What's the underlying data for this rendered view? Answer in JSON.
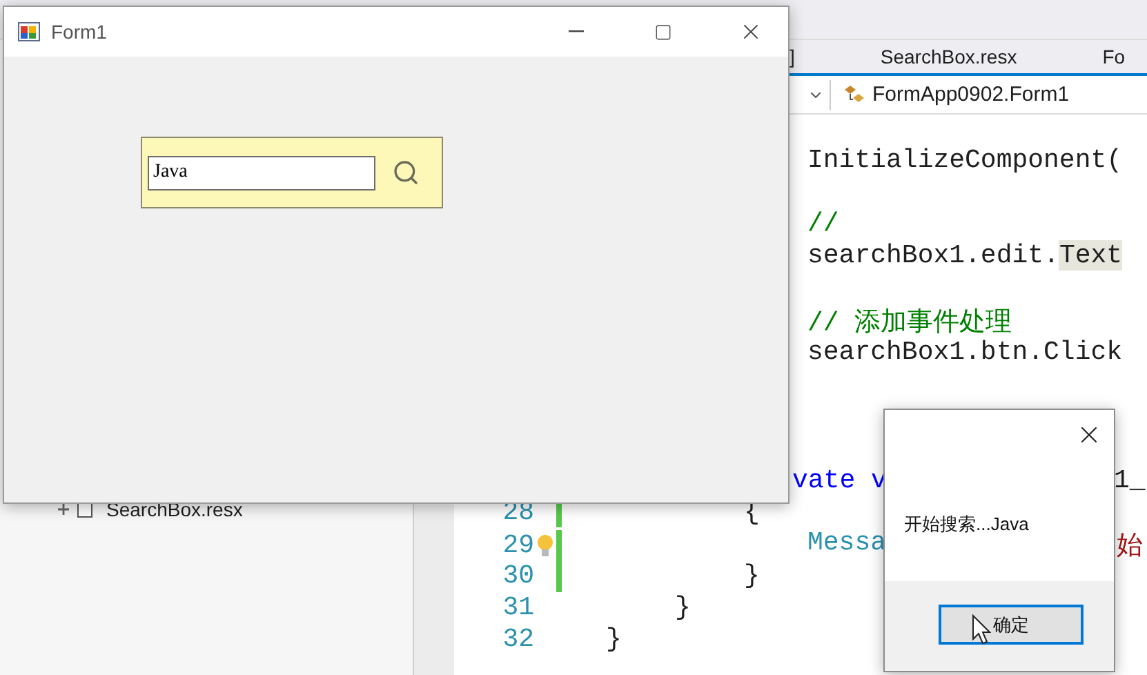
{
  "ide": {
    "tabs": [
      {
        "label": "]",
        "selected": false
      },
      {
        "label": "SearchBox.resx",
        "selected": false
      },
      {
        "label": "Fo",
        "selected": false
      }
    ],
    "navigation_bar": {
      "type_dropdown": "FormApp0902.Form1"
    },
    "solution_explorer": {
      "items": [
        {
          "label": "SearchBox.resx",
          "expanded": false
        }
      ]
    },
    "editor": {
      "lines": [
        {
          "segments": [
            {
              "text": "InitializeComponent(",
              "kind": "plain"
            }
          ]
        },
        {
          "segments": [
            {
              "text": "//",
              "kind": "comment"
            }
          ]
        },
        {
          "segments": [
            {
              "text": "searchBox1.edit.",
              "kind": "plain"
            },
            {
              "text": "Text",
              "kind": "highlight"
            }
          ]
        },
        {
          "segments": [
            {
              "text": "// 添加事件处理",
              "kind": "comment"
            }
          ]
        },
        {
          "segments": [
            {
              "text": "searchBox1.btn.Click",
              "kind": "plain"
            }
          ]
        },
        {
          "segments": [
            {
              "text": "vate v",
              "kind": "keyword"
            },
            {
              "text": "1_",
              "kind": "plain"
            }
          ]
        },
        {
          "number": "28",
          "changed": true,
          "segments": [
            {
              "text": "{",
              "kind": "plain"
            }
          ]
        },
        {
          "number": "29",
          "changed": true,
          "lightbulb": true,
          "segments": [
            {
              "text": "Messa",
              "kind": "type"
            },
            {
              "text": "始",
              "kind": "string"
            }
          ]
        },
        {
          "number": "30",
          "changed": true,
          "segments": [
            {
              "text": "}",
              "kind": "plain"
            }
          ]
        },
        {
          "number": "31",
          "changed": false,
          "segments": [
            {
              "text": "}",
              "kind": "plain"
            }
          ]
        },
        {
          "number": "32",
          "changed": false,
          "segments": [
            {
              "text": "}",
              "kind": "plain"
            }
          ]
        }
      ]
    }
  },
  "form_window": {
    "title": "Form1",
    "search_box": {
      "value": "Java"
    }
  },
  "message_box": {
    "message": "开始搜索...Java",
    "buttons": [
      {
        "label": "确定",
        "focused": true
      }
    ]
  }
}
